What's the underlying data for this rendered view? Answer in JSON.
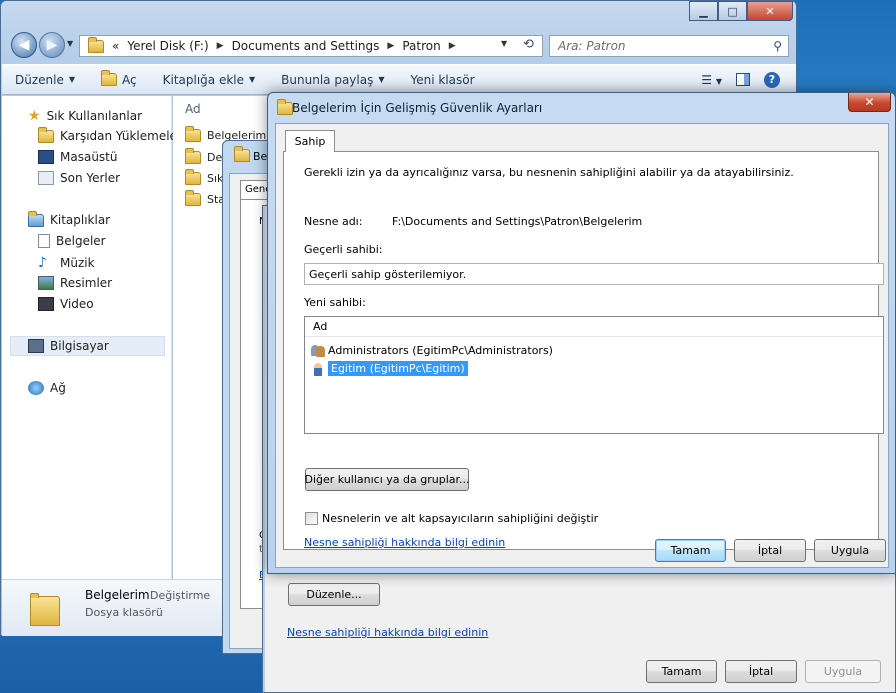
{
  "explorer": {
    "address_parts": [
      "«",
      "Yerel Disk (F:)",
      "Documents and Settings",
      "Patron"
    ],
    "search_placeholder": "Ara: Patron",
    "toolbar": {
      "organize": "Düzenle",
      "open": "Aç",
      "add_to_library": "Kitaplığa ekle",
      "share_with": "Bununla paylaş",
      "new_folder": "Yeni klasör"
    },
    "nav": {
      "favorites": "Sık Kullanılanlar",
      "downloads": "Karşıdan Yüklemeler",
      "desktop": "Masaüstü",
      "recent": "Son Yerler",
      "libraries": "Kitaplıklar",
      "documents": "Belgeler",
      "music": "Müzik",
      "pictures": "Resimler",
      "video": "Video",
      "computer": "Bilgisayar",
      "network": "Ağ"
    },
    "column_header": "Ad",
    "files": [
      "Belgelerim",
      "Des",
      "Sık",
      "Star"
    ],
    "details": {
      "name": "Belgelerim",
      "type": "Dosya klasörü",
      "modified_label": "Değiştirme"
    }
  },
  "dialog_b": {
    "title_fragment": "Be",
    "tab_fragment": "Gene",
    "text_fragment": "N",
    "fragment_c": "C",
    "fragment_ti": "ti",
    "fragment_e": "E"
  },
  "dialog_c": {
    "edit_button": "Düzenle...",
    "link": "Nesne sahipliği hakkında bilgi edinin",
    "ok": "Tamam",
    "cancel": "İptal",
    "apply": "Uygula"
  },
  "dialog": {
    "title": "Belgelerim İçin Gelişmiş Güvenlik Ayarları",
    "tab": "Sahip",
    "intro": "Gerekli izin ya da ayrıcalığınız varsa, bu nesnenin sahipliğini alabilir ya da atayabilirsiniz.",
    "object_label": "Nesne adı:",
    "object_value": "F:\\Documents and Settings\\Patron\\Belgelerim",
    "current_owner_label": "Geçerli sahibi:",
    "current_owner_value": "Geçerli sahip gösterilemiyor.",
    "new_owner_label": "Yeni sahibi:",
    "list_header": "Ad",
    "owners": [
      "Administrators (EgitimPc\\Administrators)",
      "Egitim (EgitimPc\\Egitim)"
    ],
    "other_users_button": "Diğer kullanıcı ya da gruplar...",
    "replace_checkbox": "Nesnelerin ve alt kapsayıcıların sahipliğini değiştir",
    "link": "Nesne sahipliği hakkında bilgi edinin",
    "ok": "Tamam",
    "cancel": "İptal",
    "apply": "Uygula"
  },
  "colors": {
    "selection": "#3399ff",
    "link": "#0645ad",
    "close_red": "#c7482e"
  }
}
